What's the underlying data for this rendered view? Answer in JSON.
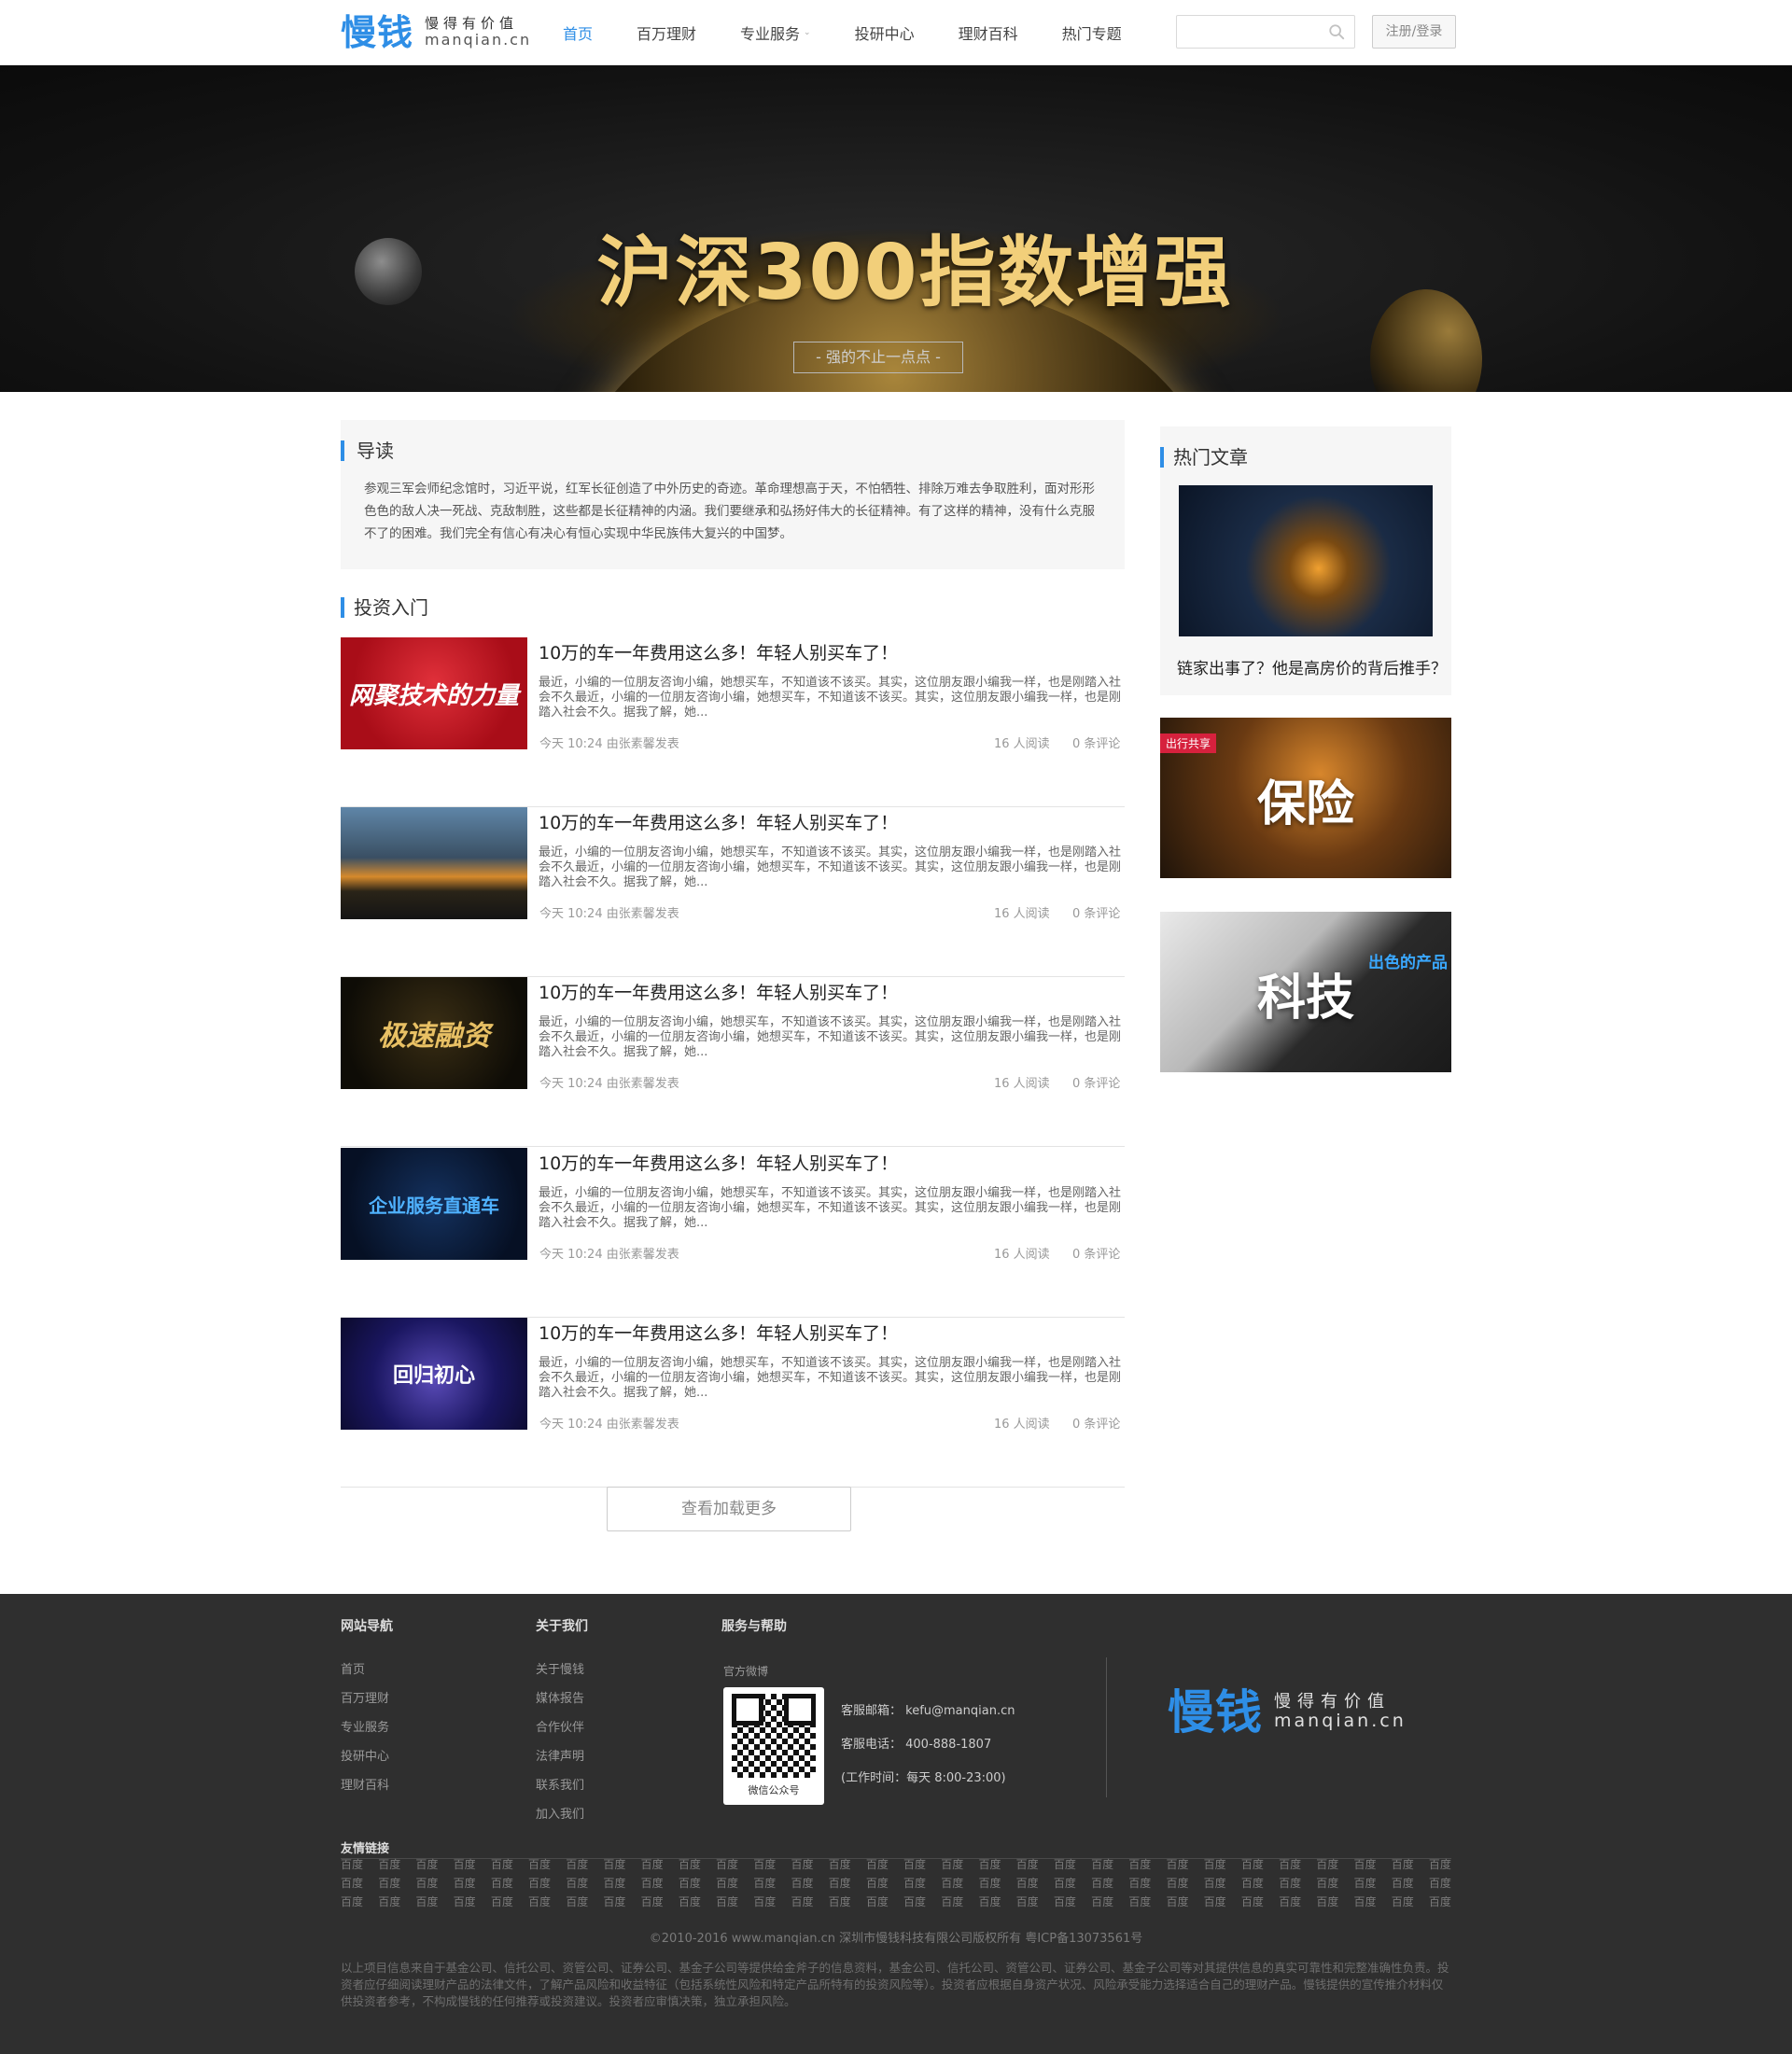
{
  "header": {
    "logo_mark": "慢钱",
    "logo_slogan": "慢得有价值",
    "logo_domain": "manqian.cn",
    "nav": [
      {
        "label": "首页",
        "active": true
      },
      {
        "label": "百万理财"
      },
      {
        "label": "专业服务",
        "has_dropdown": true
      },
      {
        "label": "投研中心"
      },
      {
        "label": "理财百科"
      },
      {
        "label": "热门专题"
      }
    ],
    "search_value": "",
    "search_icon": "search-icon",
    "login_label": "注册/登录",
    "accent_color": "#2e8ee6"
  },
  "banner": {
    "title": "沪深300指数增强",
    "subtitle": "- 强的不止一点点 -"
  },
  "intro": {
    "title": "导读",
    "text": "参观三军会师纪念馆时，习近平说，红军长征创造了中外历史的奇迹。革命理想高于天，不怕牺牲、排除万难去争取胜利，面对形形色色的敌人决一死战、克敌制胜，这些都是长征精神的内涵。我们要继承和弘扬好伟大的长征精神。有了这样的精神，没有什么克服不了的困难。我们完全有信心有决心有恒心实现中华民族伟大复兴的中国梦。"
  },
  "articles_section": {
    "title": "投资入门",
    "articles": [
      {
        "thumb_text": "网聚技术的力量",
        "title": "10万的车一年费用这么多！年轻人别买车了！",
        "desc": "最近，小编的一位朋友咨询小编，她想买车，不知道该不该买。其实，这位朋友跟小编我一样，也是刚踏入社会不久最近，小编的一位朋友咨询小编，她想买车，不知道该不该买。其实，这位朋友跟小编我一样，也是刚踏入社会不久。据我了解，她...",
        "meta": "今天 10:24 由张素馨发表",
        "reads": "16 人阅读",
        "comments": "0 条评论"
      },
      {
        "thumb_text": "",
        "title": "10万的车一年费用这么多！年轻人别买车了！",
        "desc": "最近，小编的一位朋友咨询小编，她想买车，不知道该不该买。其实，这位朋友跟小编我一样，也是刚踏入社会不久最近，小编的一位朋友咨询小编，她想买车，不知道该不该买。其实，这位朋友跟小编我一样，也是刚踏入社会不久。据我了解，她...",
        "meta": "今天 10:24 由张素馨发表",
        "reads": "16 人阅读",
        "comments": "0 条评论"
      },
      {
        "thumb_text": "极速融资",
        "title": "10万的车一年费用这么多！年轻人别买车了！",
        "desc": "最近，小编的一位朋友咨询小编，她想买车，不知道该不该买。其实，这位朋友跟小编我一样，也是刚踏入社会不久最近，小编的一位朋友咨询小编，她想买车，不知道该不该买。其实，这位朋友跟小编我一样，也是刚踏入社会不久。据我了解，她...",
        "meta": "今天 10:24 由张素馨发表",
        "reads": "16 人阅读",
        "comments": "0 条评论"
      },
      {
        "thumb_text": "企业服务直通车",
        "title": "10万的车一年费用这么多！年轻人别买车了！",
        "desc": "最近，小编的一位朋友咨询小编，她想买车，不知道该不该买。其实，这位朋友跟小编我一样，也是刚踏入社会不久最近，小编的一位朋友咨询小编，她想买车，不知道该不该买。其实，这位朋友跟小编我一样，也是刚踏入社会不久。据我了解，她...",
        "meta": "今天 10:24 由张素馨发表",
        "reads": "16 人阅读",
        "comments": "0 条评论"
      },
      {
        "thumb_text": "回归初心",
        "title": "10万的车一年费用这么多！年轻人别买车了！",
        "desc": "最近，小编的一位朋友咨询小编，她想买车，不知道该不该买。其实，这位朋友跟小编我一样，也是刚踏入社会不久最近，小编的一位朋友咨询小编，她想买车，不知道该不该买。其实，这位朋友跟小编我一样，也是刚踏入社会不久。据我了解，她...",
        "meta": "今天 10:24 由张素馨发表",
        "reads": "16 人阅读",
        "comments": "0 条评论"
      }
    ],
    "load_more": "查看加载更多"
  },
  "sidebar": {
    "hot_title": "热门文章",
    "hot_caption": "链家出事了？他是高房价的背后推手？",
    "promo1": {
      "tag": "出行共享",
      "word": "保险"
    },
    "promo2": {
      "tag": "出色的产品",
      "word": "科技"
    }
  },
  "footer": {
    "col1": {
      "head": "网站导航",
      "links": [
        "首页",
        "百万理财",
        "专业服务",
        "投研中心",
        "理财百科"
      ]
    },
    "col2": {
      "head": "关于我们",
      "links": [
        "关于慢钱",
        "媒体报告",
        "合作伙伴",
        "法律声明",
        "联系我们",
        "加入我们"
      ]
    },
    "col3": {
      "head": "服务与帮助",
      "weibo": "官方微博",
      "qr_label": "微信公众号"
    },
    "contact": {
      "email": "客服邮箱：  kefu@manqian.cn",
      "phone": "客服电话：  400-888-1807",
      "hours": "(工作时间：每天  8:00-23:00)"
    },
    "friend_head": "友情链接",
    "friend_link": "百度",
    "copyright": "©2010-2016 www.manqian.cn 深圳市慢钱科技有限公司版权所有   粤ICP备13073561号",
    "disclaimer": "以上项目信息来自于基金公司、信托公司、资管公司、证券公司、基金子公司等提供给金斧子的信息资料，基金公司、信托公司、资管公司、证券公司、基金子公司等对其提供信息的真实可靠性和完整准确性负责。投资者应仔细阅读理财产品的法律文件，了解产品风险和收益特征（包括系统性风险和特定产品所特有的投资风险等）。投资者应根据自身资产状况、风险承受能力选择适合自己的理财产品。慢钱提供的宣传推介材料仅供投资者参考，不构成慢钱的任何推荐或投资建议。投资者应审慎决策，独立承担风险。"
  }
}
